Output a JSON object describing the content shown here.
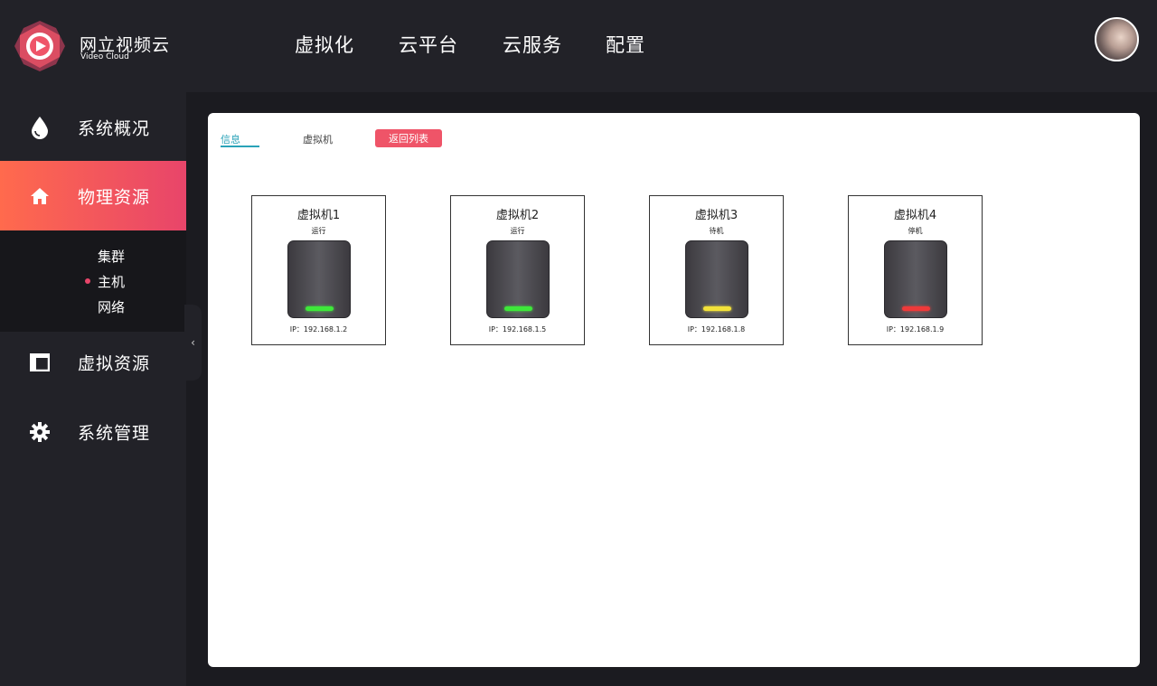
{
  "app": {
    "name": "网立视频云",
    "subtitle": "Video Cloud"
  },
  "top_nav": [
    {
      "label": "虚拟化"
    },
    {
      "label": "云平台"
    },
    {
      "label": "云服务"
    },
    {
      "label": "配置"
    }
  ],
  "sidebar": {
    "items": [
      {
        "label": "系统概况",
        "icon": "droplet-icon"
      },
      {
        "label": "物理资源",
        "icon": "home-icon",
        "active": true
      },
      {
        "label": "虚拟资源",
        "icon": "layout-icon"
      },
      {
        "label": "系统管理",
        "icon": "gear-icon"
      }
    ],
    "sub_items": [
      {
        "label": "集群"
      },
      {
        "label": "主机",
        "active": true
      },
      {
        "label": "网络"
      }
    ]
  },
  "tabs": {
    "info": "信息",
    "vm": "虚拟机",
    "back": "返回列表"
  },
  "vms": [
    {
      "name": "虚拟机1",
      "status": "运行",
      "ip": "IP：192.168.1.2",
      "led_color": "#3ee83a"
    },
    {
      "name": "虚拟机2",
      "status": "运行",
      "ip": "IP：192.168.1.5",
      "led_color": "#3ee83a"
    },
    {
      "name": "虚拟机3",
      "status": "待机",
      "ip": "IP：192.168.1.8",
      "led_color": "#f3e23a"
    },
    {
      "name": "虚拟机4",
      "status": "停机",
      "ip": "IP：192.168.1.9",
      "led_color": "#ee3a3a"
    }
  ],
  "colors": {
    "accent_gradient_start": "#ff6a4d",
    "accent_gradient_end": "#e8456a",
    "tab_active": "#2aa3b8",
    "back_button": "#ef5468"
  }
}
